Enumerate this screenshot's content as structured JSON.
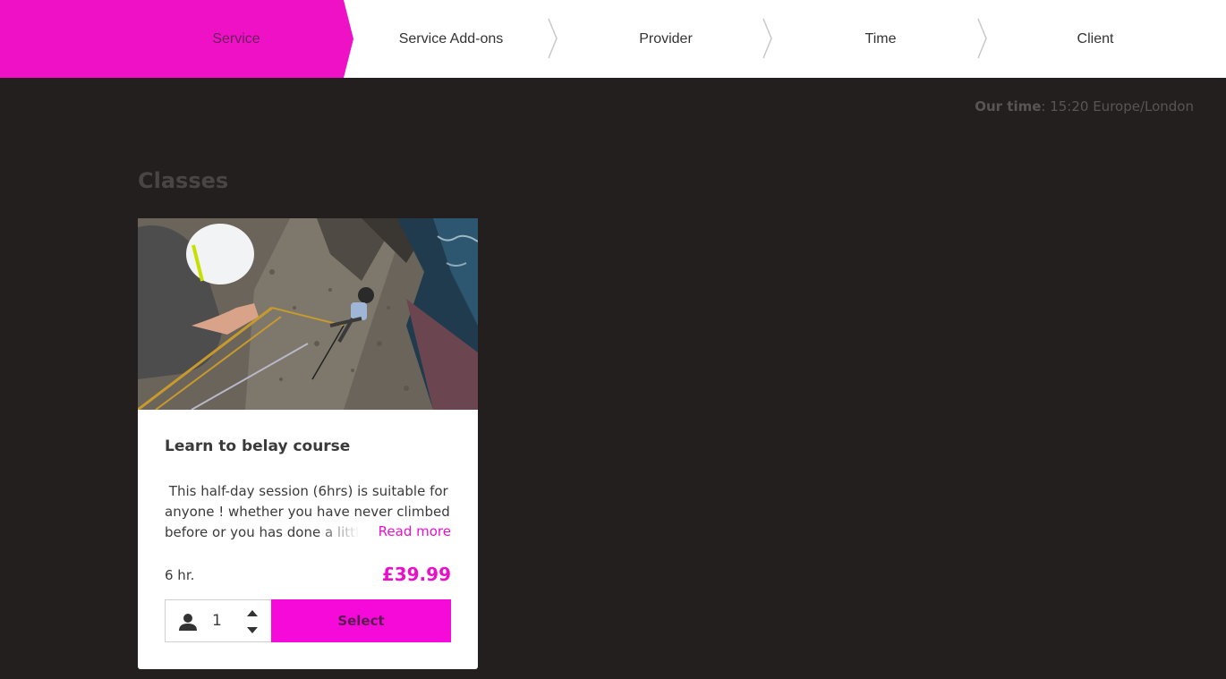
{
  "steps": [
    {
      "label": "Service",
      "active": true
    },
    {
      "label": "Service Add-ons",
      "active": false
    },
    {
      "label": "Provider",
      "active": false
    },
    {
      "label": "Time",
      "active": false
    },
    {
      "label": "Client",
      "active": false
    }
  ],
  "our_time": {
    "label": "Our time",
    "value": ": 15:20 Europe/London"
  },
  "category": "Classes",
  "card": {
    "image_icon": "rock-climbing-photo",
    "title": "Learn to belay course",
    "description": " This half-day session (6hrs) is suitable for anyone ! whether you have never climbed before or you has done a little",
    "read_more": "Read more",
    "duration": "6 hr.",
    "price": "£39.99",
    "quantity": "1",
    "select_label": "Select"
  },
  "colors": {
    "accent": "#f50ad9",
    "accent_text": "#e811c9",
    "background": "#231f1f"
  }
}
